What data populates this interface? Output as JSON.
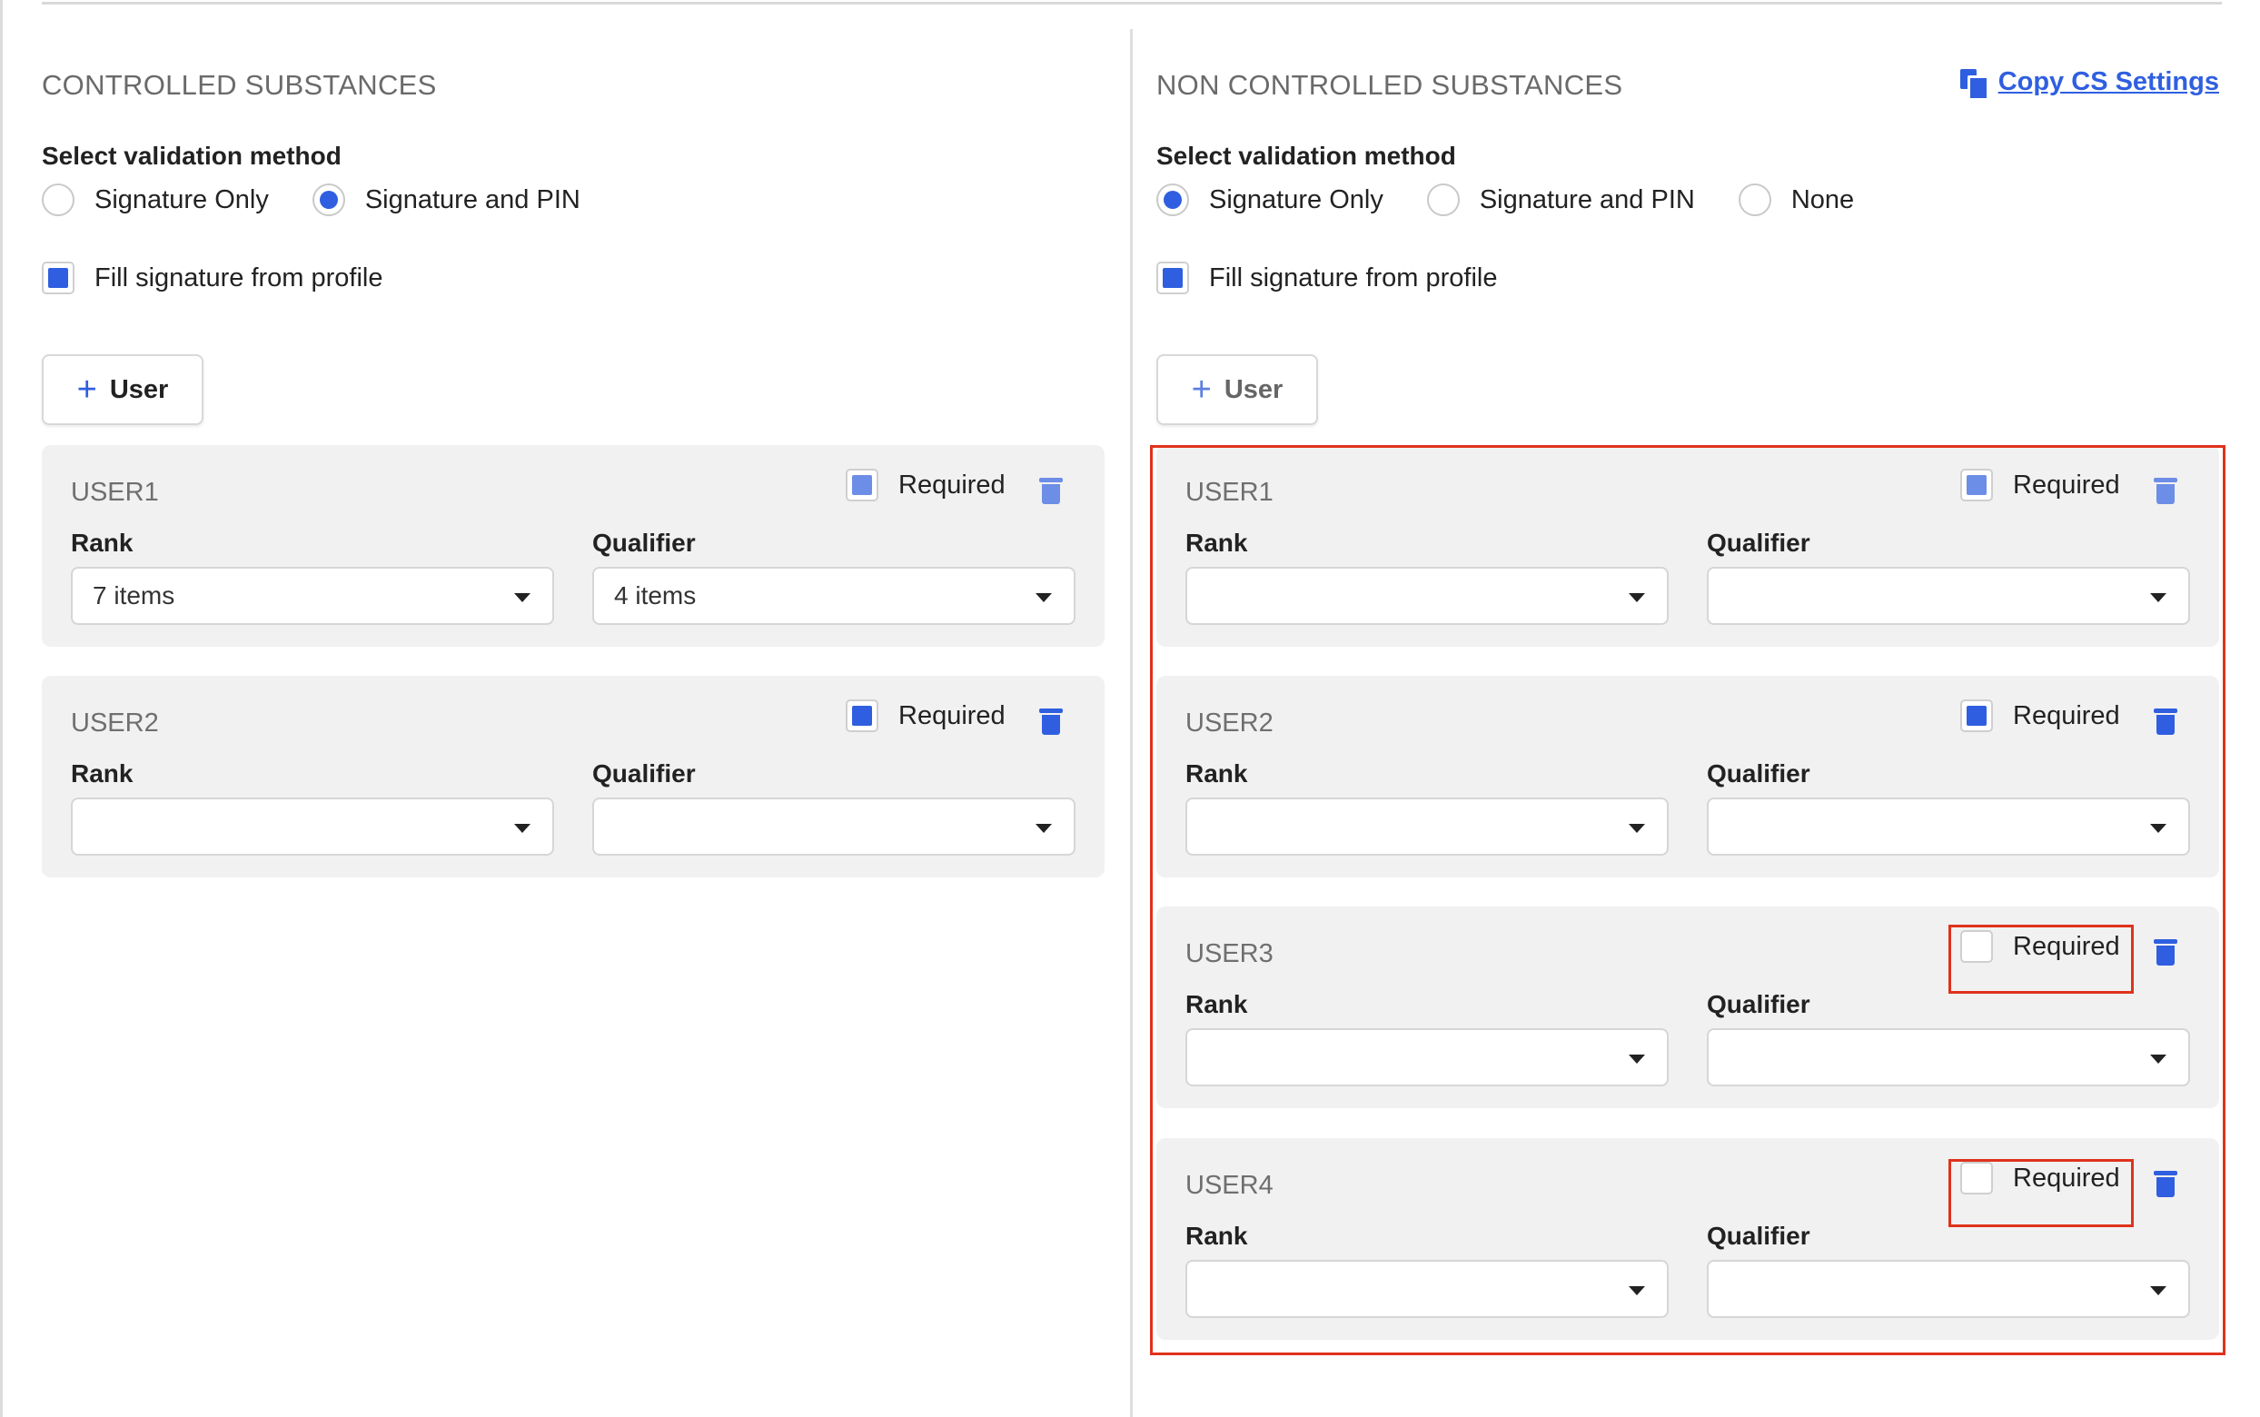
{
  "cs": {
    "title": "CONTROLLED SUBSTANCES",
    "validation_label": "Select validation method",
    "options": [
      "Signature Only",
      "Signature and PIN"
    ],
    "selected_option": "Signature and PIN",
    "fill_signature": "Fill signature from profile",
    "fill_signature_checked": true,
    "add_user_label": "User",
    "users": [
      {
        "name": "USER1",
        "required": "Required",
        "required_checked": true,
        "rank_label": "Rank",
        "rank_value": "7 items",
        "qualifier_label": "Qualifier",
        "qualifier_value": "4 items"
      },
      {
        "name": "USER2",
        "required": "Required",
        "required_checked": true,
        "rank_label": "Rank",
        "rank_value": "",
        "qualifier_label": "Qualifier",
        "qualifier_value": ""
      }
    ]
  },
  "ncs": {
    "title": "NON CONTROLLED SUBSTANCES",
    "copy_link": "Copy CS Settings",
    "validation_label": "Select validation method",
    "options": [
      "Signature Only",
      "Signature and PIN",
      "None"
    ],
    "selected_option": "Signature Only",
    "fill_signature": "Fill signature from profile",
    "fill_signature_checked": true,
    "add_user_label": "User",
    "users": [
      {
        "name": "USER1",
        "required": "Required",
        "required_checked": true,
        "rank_label": "Rank",
        "rank_value": "",
        "qualifier_label": "Qualifier",
        "qualifier_value": ""
      },
      {
        "name": "USER2",
        "required": "Required",
        "required_checked": true,
        "rank_label": "Rank",
        "rank_value": "",
        "qualifier_label": "Qualifier",
        "qualifier_value": ""
      },
      {
        "name": "USER3",
        "required": "Required",
        "required_checked": false,
        "rank_label": "Rank",
        "rank_value": "",
        "qualifier_label": "Qualifier",
        "qualifier_value": ""
      },
      {
        "name": "USER4",
        "required": "Required",
        "required_checked": false,
        "rank_label": "Rank",
        "rank_value": "",
        "qualifier_label": "Qualifier",
        "qualifier_value": ""
      }
    ]
  },
  "colors": {
    "accent": "#2f5fe0",
    "accent_light": "#6d8ee6",
    "highlight": "#e0321c",
    "card_bg": "#f1f1f1"
  },
  "icons": {
    "add": "plus-icon",
    "delete": "trash-icon",
    "copy": "copy-icon",
    "dropdown": "caret-down-icon"
  }
}
